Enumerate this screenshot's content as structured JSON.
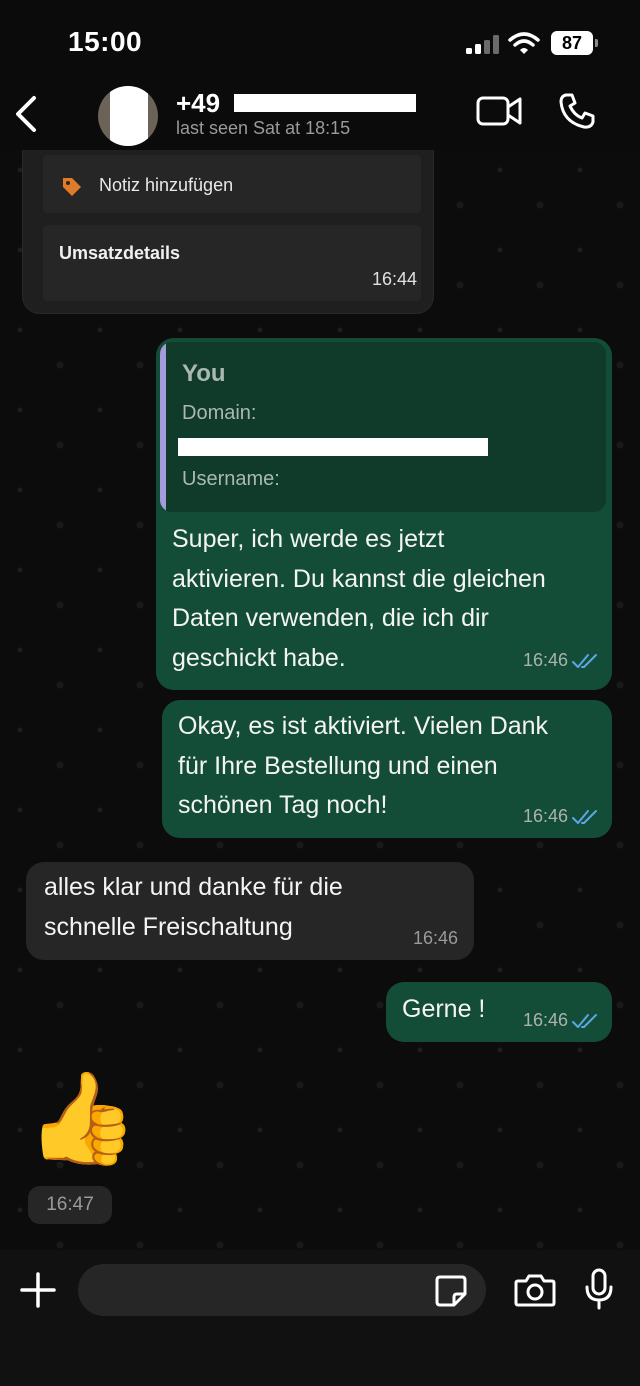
{
  "status_bar": {
    "time": "15:00",
    "battery": "87"
  },
  "header": {
    "contact_name": "+49",
    "last_seen": "last seen Sat at 18:15"
  },
  "messages": {
    "card": {
      "note_label": "Notiz hinzufügen",
      "details_label": "Umsatzdetails",
      "time": "16:44"
    },
    "m1": {
      "quote_author": "You",
      "quote_domain": "Domain:",
      "quote_username": "Username:",
      "lines": [
        "Super, ich werde es jetzt",
        "aktivieren. Du kannst die gleichen",
        "Daten verwenden, die ich dir",
        "geschickt habe."
      ],
      "time": "16:46"
    },
    "m2": {
      "lines": [
        "Okay, es ist aktiviert. Vielen Dank",
        "für Ihre Bestellung und einen",
        "schönen Tag noch!"
      ],
      "time": "16:46"
    },
    "m3": {
      "lines": [
        "alles klar und danke für die",
        "schnelle Freischaltung"
      ],
      "time": "16:46"
    },
    "m4": {
      "text": "Gerne !",
      "time": "16:46"
    },
    "m5": {
      "emoji": "👍",
      "time": "16:47"
    }
  },
  "colors": {
    "outgoing_bubble": "#144d37",
    "incoming_bubble": "#262626",
    "read_ticks": "#5aa7e6",
    "quote_accent": "#a59bdc",
    "tag_icon": "#e07b2a"
  },
  "icons": [
    "back-chevron",
    "video-call",
    "phone",
    "tag",
    "double-check",
    "plus",
    "sticker",
    "camera",
    "microphone"
  ]
}
